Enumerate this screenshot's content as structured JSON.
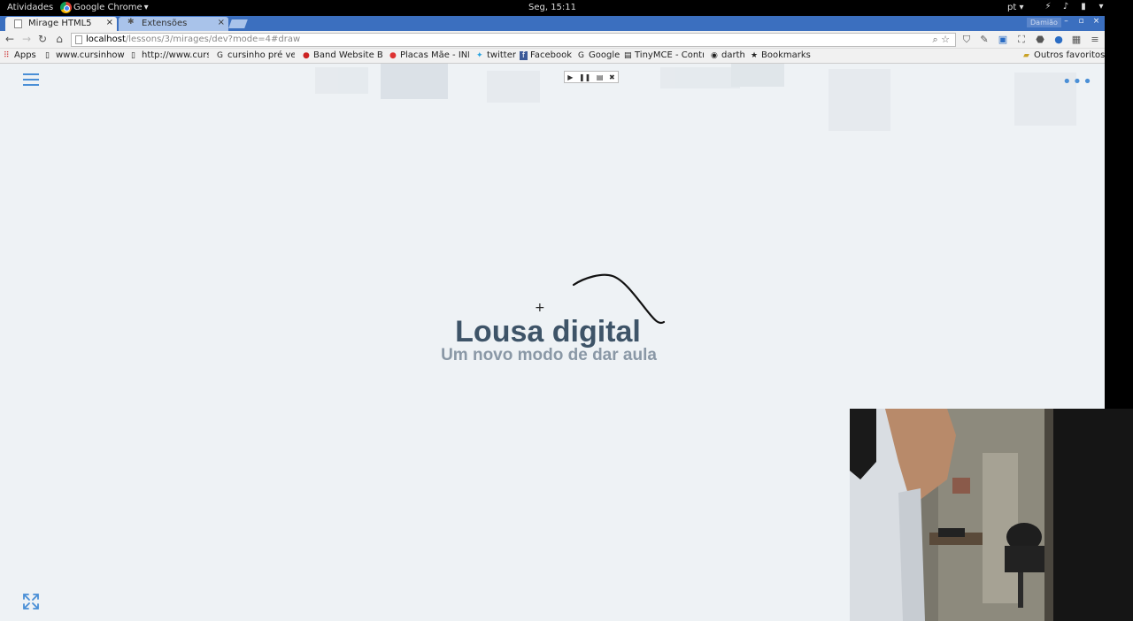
{
  "topbar": {
    "activities": "Atividades",
    "app_name": "Google Chrome",
    "clock": "Seg, 15:11",
    "language": "pt"
  },
  "tabs": [
    {
      "label": "Mirage HTML5",
      "active": true
    },
    {
      "label": "Extensões",
      "active": false
    }
  ],
  "window": {
    "profile": "Damião"
  },
  "toolbar": {
    "url_host": "localhost",
    "url_path": "/lessons/3/mirages/dev?mode=4#draw"
  },
  "bookmarks": [
    {
      "label": "Apps",
      "icon": "apps-grid-icon"
    },
    {
      "label": "www.cursinhowe",
      "icon": "page-icon"
    },
    {
      "label": "http://www.cursi",
      "icon": "page-icon"
    },
    {
      "label": "cursinho pré ves",
      "icon": "google-icon"
    },
    {
      "label": "Band Website Bu",
      "icon": "band-icon"
    },
    {
      "label": "Placas Mãe - INF",
      "icon": "apple-icon"
    },
    {
      "label": "twitter",
      "icon": "twitter-icon"
    },
    {
      "label": "Facebook",
      "icon": "facebook-icon"
    },
    {
      "label": "Google",
      "icon": "google-icon"
    },
    {
      "label": "TinyMCE - Contr",
      "icon": "tinymce-icon"
    },
    {
      "label": "darth",
      "icon": "darth-icon"
    },
    {
      "label": "Bookmarks",
      "icon": "star-icon"
    }
  ],
  "other_bookmarks": "Outros favoritos",
  "slide": {
    "title": "Lousa digital",
    "subtitle": "Um novo modo de dar aula"
  },
  "player_controls": [
    "play-icon",
    "pause-icon",
    "screen-icon",
    "close-icon"
  ],
  "colors": {
    "accent": "#4a8fd6",
    "title": "#3e5468",
    "subtitle": "#8a98a6",
    "background": "#eef2f5",
    "tabstrip": "#3b6fbf"
  }
}
